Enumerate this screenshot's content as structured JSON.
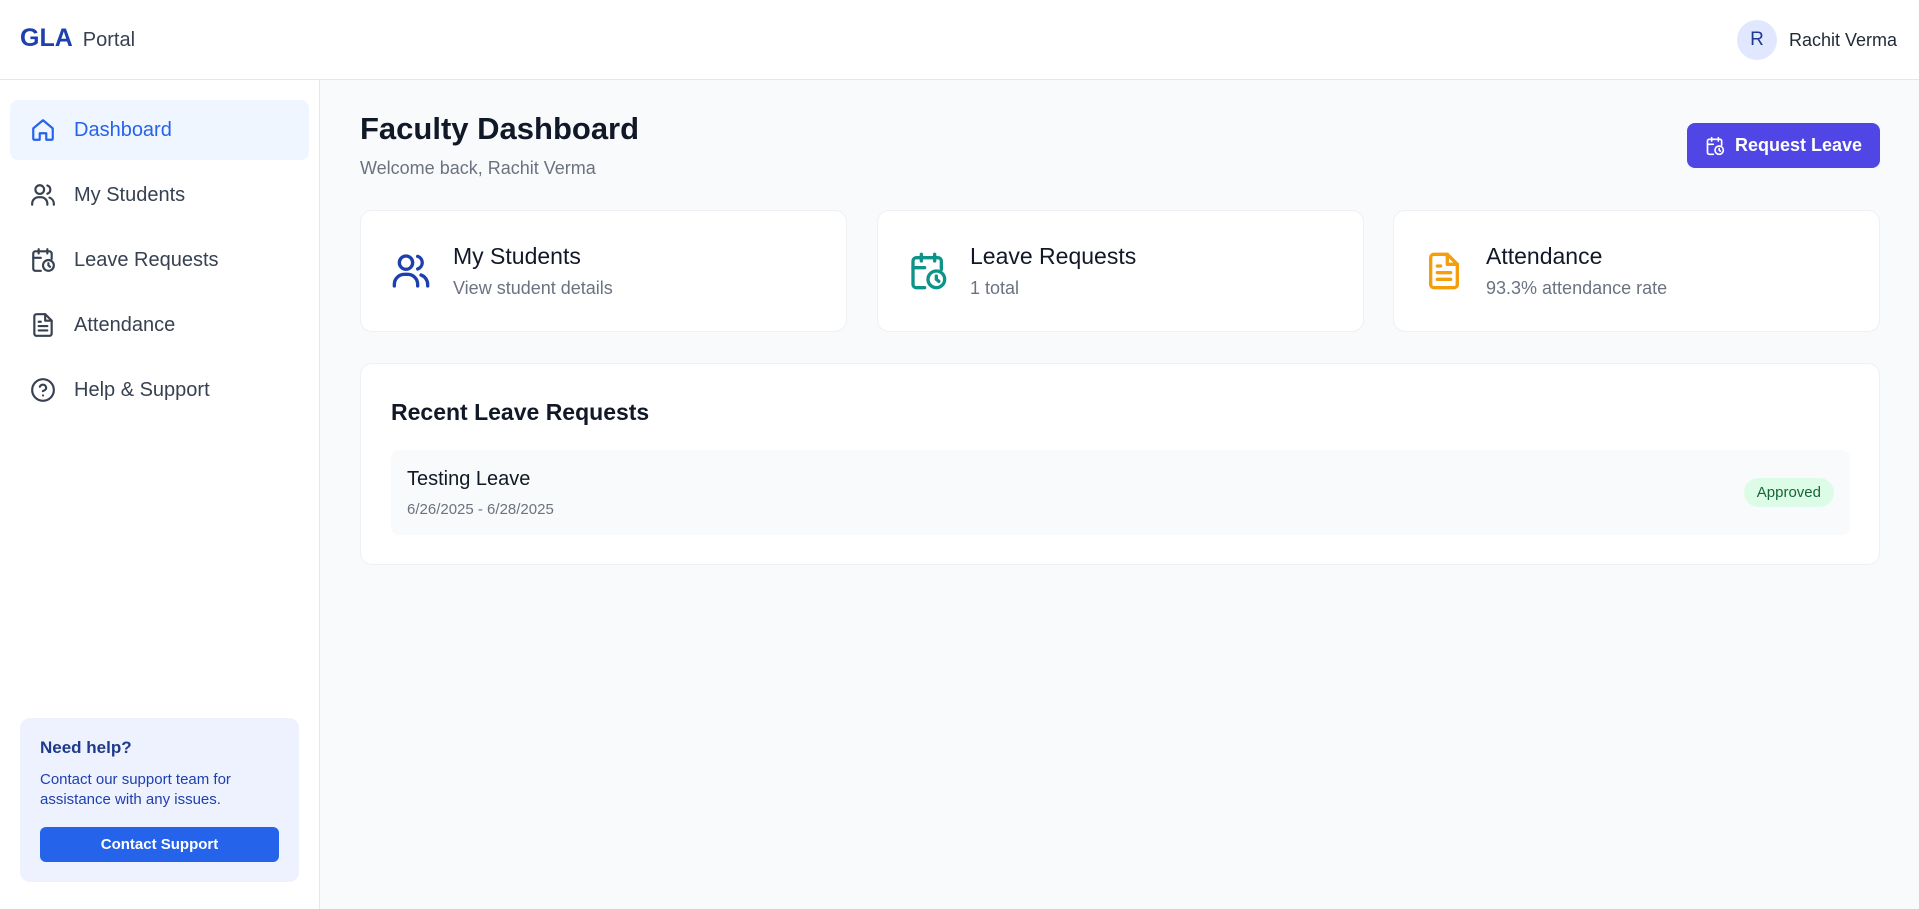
{
  "header": {
    "brand": "GLA",
    "portal": "Portal",
    "user": {
      "initial": "R",
      "name": "Rachit Verma"
    }
  },
  "sidebar": {
    "items": [
      {
        "label": "Dashboard",
        "icon": "home-icon",
        "active": true
      },
      {
        "label": "My Students",
        "icon": "users-icon"
      },
      {
        "label": "Leave Requests",
        "icon": "calendar-clock-icon"
      },
      {
        "label": "Attendance",
        "icon": "document-icon"
      },
      {
        "label": "Help & Support",
        "icon": "help-circle-icon"
      }
    ],
    "help": {
      "title": "Need help?",
      "text": "Contact our support team for assistance with any issues.",
      "button": "Contact Support"
    }
  },
  "main": {
    "title": "Faculty Dashboard",
    "subtitle": "Welcome back, Rachit Verma",
    "request_button": "Request Leave",
    "cards": [
      {
        "title": "My Students",
        "subtitle": "View student details",
        "icon": "users-icon",
        "color": "#1e40af"
      },
      {
        "title": "Leave Requests",
        "subtitle": "1 total",
        "icon": "calendar-clock-icon",
        "color": "#0d9488"
      },
      {
        "title": "Attendance",
        "subtitle": "93.3% attendance rate",
        "icon": "document-icon",
        "color": "#f59e0b"
      }
    ],
    "recent": {
      "title": "Recent Leave Requests",
      "items": [
        {
          "name": "Testing Leave",
          "dates": "6/26/2025 - 6/28/2025",
          "status": "Approved"
        }
      ]
    }
  },
  "colors": {
    "brand": "#1e40af",
    "primary": "#2563eb",
    "accent": "#4f46e5",
    "approved_bg": "#dcfce7",
    "approved_text": "#166534"
  }
}
